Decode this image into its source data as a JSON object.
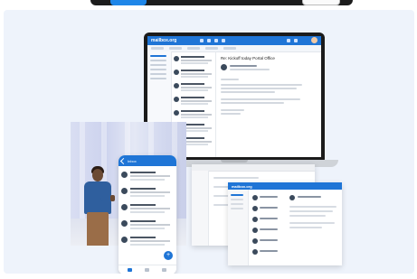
{
  "brand": {
    "accent": "#1f75d6",
    "laptop_logo": "mailbox.org"
  },
  "laptop_email": {
    "subject": "Re: Kickoff today Portal Office"
  },
  "phone_app": {
    "header_title": "Inbox",
    "fab_icon": "plus-icon"
  },
  "desktop_window": {
    "logo": "mailbox.org"
  }
}
